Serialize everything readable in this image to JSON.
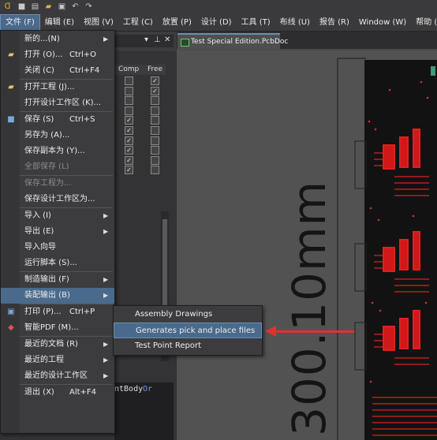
{
  "menubar": {
    "items": [
      {
        "label": "文件 (F)"
      },
      {
        "label": "编辑 (E)"
      },
      {
        "label": "视图 (V)"
      },
      {
        "label": "工程 (C)"
      },
      {
        "label": "放置 (P)"
      },
      {
        "label": "设计 (D)"
      },
      {
        "label": "工具 (T)"
      },
      {
        "label": "布线 (U)"
      },
      {
        "label": "报告 (R)"
      },
      {
        "label": "Window (W)"
      },
      {
        "label": "帮助 (H)"
      }
    ]
  },
  "document_tab": {
    "label": "Test Special Edition.PcbDoc"
  },
  "table": {
    "headers": [
      "Comp",
      "Free"
    ],
    "rows": [
      {
        "comp": false,
        "free": true
      },
      {
        "comp": false,
        "free": true
      },
      {
        "comp": false,
        "free": false
      },
      {
        "comp": false,
        "free": false
      },
      {
        "comp": true,
        "free": false
      },
      {
        "comp": true,
        "free": false
      },
      {
        "comp": true,
        "free": false
      },
      {
        "comp": true,
        "free": false
      },
      {
        "comp": true,
        "free": false
      },
      {
        "comp": true,
        "free": false
      }
    ]
  },
  "code_panel": {
    "text1": "ntBody",
    "text2": "Or"
  },
  "canvas": {
    "dimension_text": "300.10mm"
  },
  "file_menu": {
    "items": [
      {
        "label": "新的...(N)",
        "shortcut": "",
        "arrow": true,
        "icon": ""
      },
      {
        "label": "打开 (O)...",
        "shortcut": "Ctrl+O",
        "arrow": false,
        "icon": "open-folder-icon"
      },
      {
        "label": "关闭 (C)",
        "shortcut": "Ctrl+F4",
        "arrow": false,
        "icon": ""
      },
      {
        "label": "打开工程 (J)...",
        "shortcut": "",
        "arrow": false,
        "icon": "open-project-icon"
      },
      {
        "label": "打开设计工作区 (K)...",
        "shortcut": "",
        "arrow": false,
        "icon": ""
      },
      {
        "label": "保存 (S)",
        "shortcut": "Ctrl+S",
        "arrow": false,
        "icon": "save-icon"
      },
      {
        "label": "另存为 (A)...",
        "shortcut": "",
        "arrow": false,
        "icon": ""
      },
      {
        "label": "保存副本为 (Y)...",
        "shortcut": "",
        "arrow": false,
        "icon": ""
      },
      {
        "label": "全部保存 (L)",
        "shortcut": "",
        "arrow": false,
        "icon": "",
        "disabled": true
      },
      {
        "label": "保存工程为...",
        "shortcut": "",
        "arrow": false,
        "icon": "",
        "disabled": true
      },
      {
        "label": "保存设计工作区为...",
        "shortcut": "",
        "arrow": false,
        "icon": ""
      },
      {
        "label": "导入 (I)",
        "shortcut": "",
        "arrow": true,
        "icon": ""
      },
      {
        "label": "导出 (E)",
        "shortcut": "",
        "arrow": true,
        "icon": ""
      },
      {
        "label": "导入向导",
        "shortcut": "",
        "arrow": false,
        "icon": ""
      },
      {
        "label": "运行脚本 (S)...",
        "shortcut": "",
        "arrow": false,
        "icon": ""
      },
      {
        "label": "制造输出 (F)",
        "shortcut": "",
        "arrow": true,
        "icon": ""
      },
      {
        "label": "装配输出 (B)",
        "shortcut": "",
        "arrow": true,
        "icon": ""
      },
      {
        "label": "打印 (P)...",
        "shortcut": "Ctrl+P",
        "arrow": false,
        "icon": "print-icon"
      },
      {
        "label": "智能PDF (M)...",
        "shortcut": "",
        "arrow": false,
        "icon": "pdf-icon"
      },
      {
        "label": "最近的文档 (R)",
        "shortcut": "",
        "arrow": true,
        "icon": ""
      },
      {
        "label": "最近的工程",
        "shortcut": "",
        "arrow": true,
        "icon": ""
      },
      {
        "label": "最近的设计工作区",
        "shortcut": "",
        "arrow": true,
        "icon": ""
      },
      {
        "label": "退出 (X)",
        "shortcut": "Alt+F4",
        "arrow": false,
        "icon": ""
      }
    ]
  },
  "assembly_submenu": {
    "items": [
      {
        "label": "Assembly Drawings"
      },
      {
        "label": "Generates pick and place files"
      },
      {
        "label": "Test Point Report"
      }
    ]
  },
  "colors": {
    "highlight": "#4a6a8c",
    "trace_red": "#e02020",
    "arrow_red": "#e03030"
  }
}
